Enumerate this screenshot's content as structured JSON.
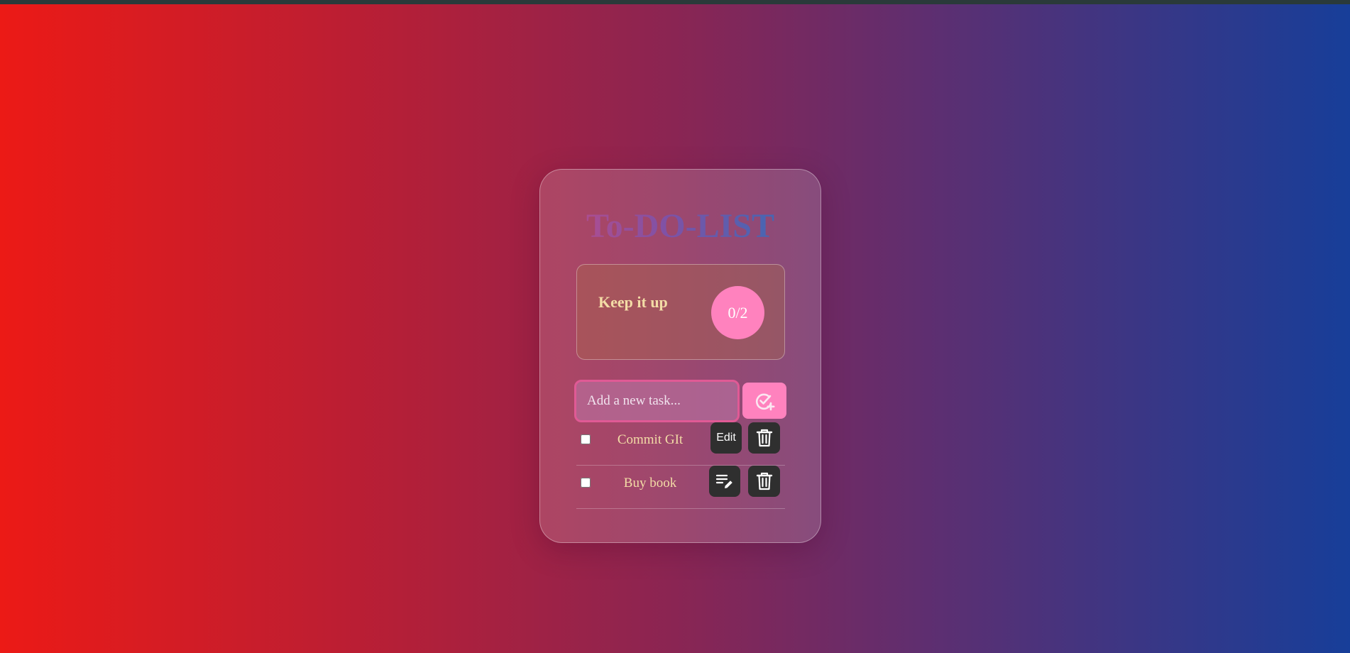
{
  "app": {
    "title": "To-DO-LIST"
  },
  "stats": {
    "message": "Keep it up",
    "counter": "0/2",
    "completed": 0,
    "total": 2
  },
  "input": {
    "placeholder": "Add a new task...",
    "value": ""
  },
  "tasks": [
    {
      "text": "Commit GIt",
      "done": false,
      "edit_label": "Edit",
      "edit_icon": "text-label",
      "delete_icon": "trash-icon"
    },
    {
      "text": "Buy book",
      "done": false,
      "edit_label": "",
      "edit_icon": "edit-list-icon",
      "delete_icon": "trash-icon"
    }
  ],
  "colors": {
    "accent_pink": "#ff82be",
    "button_dark": "#2f2f2f",
    "text_cream": "#f3dca6",
    "gradient_left": "#ec1a16",
    "gradient_right": "#173e99"
  }
}
